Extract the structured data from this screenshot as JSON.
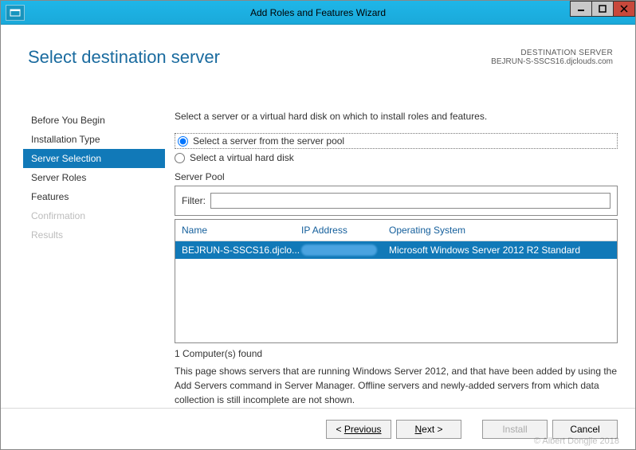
{
  "window": {
    "title": "Add Roles and Features Wizard"
  },
  "header": {
    "page_title": "Select destination server",
    "dest_label": "DESTINATION SERVER",
    "dest_value": "BEJRUN-S-SSCS16.djclouds.com"
  },
  "sidebar": {
    "items": [
      {
        "label": "Before You Begin",
        "selected": false,
        "disabled": false
      },
      {
        "label": "Installation Type",
        "selected": false,
        "disabled": false
      },
      {
        "label": "Server Selection",
        "selected": true,
        "disabled": false
      },
      {
        "label": "Server Roles",
        "selected": false,
        "disabled": false
      },
      {
        "label": "Features",
        "selected": false,
        "disabled": false
      },
      {
        "label": "Confirmation",
        "selected": false,
        "disabled": true
      },
      {
        "label": "Results",
        "selected": false,
        "disabled": true
      }
    ]
  },
  "main": {
    "instruction": "Select a server or a virtual hard disk on which to install roles and features.",
    "radio1": "Select a server from the server pool",
    "radio2": "Select a virtual hard disk",
    "section_label": "Server Pool",
    "filter_label": "Filter:",
    "filter_value": "",
    "columns": {
      "name": "Name",
      "ip": "IP Address",
      "os": "Operating System"
    },
    "rows": [
      {
        "name": "BEJRUN-S-SSCS16.djclo...",
        "ip": "",
        "os": "Microsoft Windows Server 2012 R2 Standard"
      }
    ],
    "found_text": "1 Computer(s) found",
    "help_text": "This page shows servers that are running Windows Server 2012, and that have been added by using the Add Servers command in Server Manager. Offline servers and newly-added servers from which data collection is still incomplete are not shown."
  },
  "footer": {
    "previous": "Previous",
    "next": "Next >",
    "install": "Install",
    "cancel": "Cancel"
  },
  "watermark": "© Albert Dongjie 2018"
}
